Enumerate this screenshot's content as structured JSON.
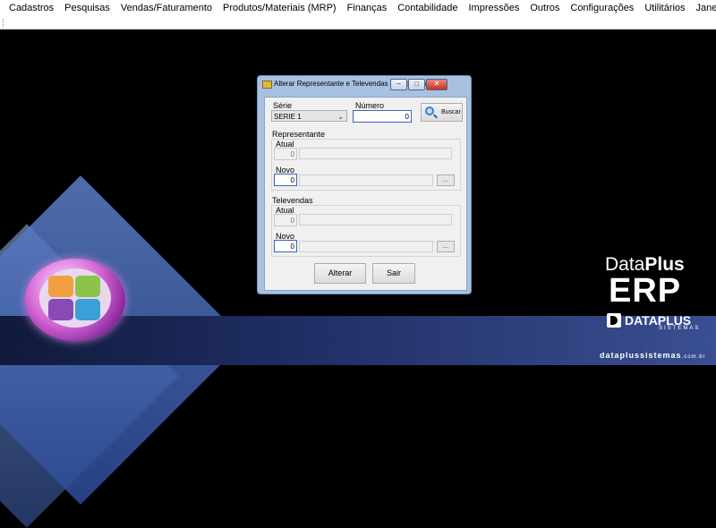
{
  "menu": [
    "Cadastros",
    "Pesquisas",
    "Vendas/Faturamento",
    "Produtos/Materiais (MRP)",
    "Finanças",
    "Contabilidade",
    "Impressões",
    "Outros",
    "Configurações",
    "Utilitários",
    "Janelas"
  ],
  "dialog": {
    "title": "Alterar Representante e Televendas da Nota Fiscal",
    "serie_label": "Série",
    "serie_value": "SERIE 1",
    "numero_label": "Número",
    "numero_value": "0",
    "buscar_label": "Buscar",
    "representante": {
      "group_label": "Representante",
      "atual_label": "Atual",
      "atual_value": "0",
      "novo_label": "Novo",
      "novo_value": "0",
      "ellipsis": "..."
    },
    "televendas": {
      "group_label": "Televendas",
      "atual_label": "Atual",
      "atual_value": "0",
      "novo_label": "Novo",
      "novo_value": "0",
      "ellipsis": "..."
    },
    "alterar_label": "Alterar",
    "sair_label": "Sair"
  },
  "brand": {
    "line1_a": "Data",
    "line1_b": "Plus",
    "line2": "ERP",
    "line3": "DATAPLUS",
    "line4": "SISTEMAS",
    "url": "dataplussistemas",
    "url_suffix": ".com.br"
  }
}
